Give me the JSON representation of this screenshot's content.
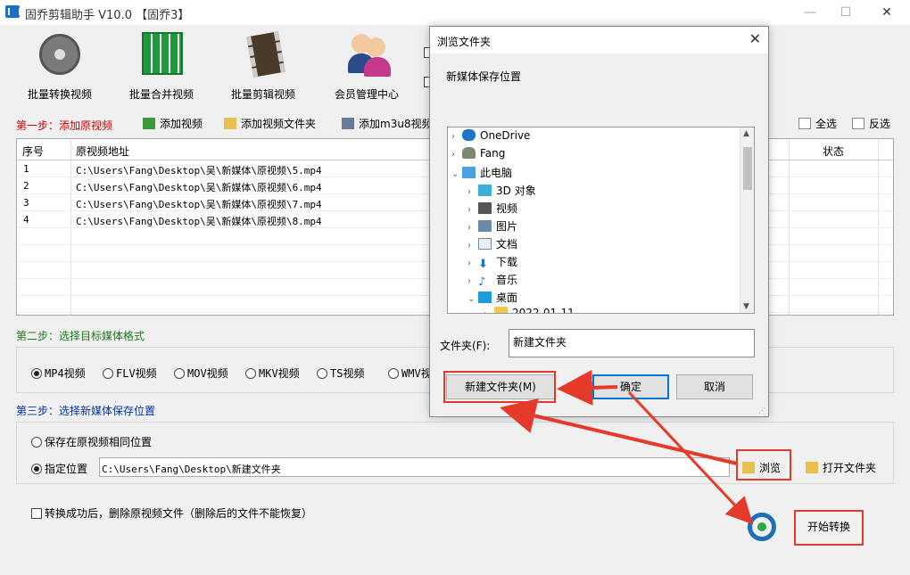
{
  "window": {
    "title": "固乔剪辑助手 V10.0  【固乔3】"
  },
  "toolbar": {
    "batch_convert": "批量转换视频",
    "batch_merge": "批量合并视频",
    "batch_edit": "批量剪辑视频",
    "member_center": "会员管理中心"
  },
  "step1": {
    "label": "第一步：添加原视频",
    "add_video": "添加视频",
    "add_folder": "添加视频文件夹",
    "add_m3u8": "添加m3u8视频地",
    "select_all": "全选",
    "invert": "反选"
  },
  "table": {
    "headers": {
      "index": "序号",
      "path": "原视频地址",
      "status": "状态"
    },
    "rows": [
      {
        "index": "1",
        "path": "C:\\Users\\Fang\\Desktop\\吴\\新媒体\\原视频\\5.mp4"
      },
      {
        "index": "2",
        "path": "C:\\Users\\Fang\\Desktop\\吴\\新媒体\\原视频\\6.mp4"
      },
      {
        "index": "3",
        "path": "C:\\Users\\Fang\\Desktop\\吴\\新媒体\\原视频\\7.mp4"
      },
      {
        "index": "4",
        "path": "C:\\Users\\Fang\\Desktop\\吴\\新媒体\\原视频\\8.mp4"
      }
    ]
  },
  "step2": {
    "label": "第二步：选择目标媒体格式",
    "formats": [
      "MP4视频",
      "FLV视频",
      "MOV视频",
      "MKV视频",
      "TS视频",
      "WMV视"
    ],
    "selected": "MP4视频"
  },
  "step3": {
    "label": "第三步：选择新媒体保存位置",
    "same_location": "保存在原视频相同位置",
    "custom_location": "指定位置",
    "path_value": "C:\\Users\\Fang\\Desktop\\新建文件夹",
    "browse": "浏览",
    "open_folder": "打开文件夹"
  },
  "delete_option": "转换成功后，删除原视频文件（删除后的文件不能恢复）",
  "start_button": "开始转换",
  "dialog": {
    "title": "浏览文件夹",
    "description": "新媒体保存位置",
    "tree": [
      "OneDrive",
      "Fang",
      "此电脑",
      "3D 对象",
      "视频",
      "图片",
      "文档",
      "下载",
      "音乐",
      "桌面",
      "2022-01-11"
    ],
    "folder_label": "文件夹(F):",
    "folder_value": "新建文件夹",
    "new_folder": "新建文件夹(M)",
    "ok": "确定",
    "cancel": "取消"
  },
  "colors": {
    "step1": "#cc0000",
    "step2": "#1a7a1a",
    "step3": "#0033aa",
    "annotation": "#e53a2a"
  }
}
